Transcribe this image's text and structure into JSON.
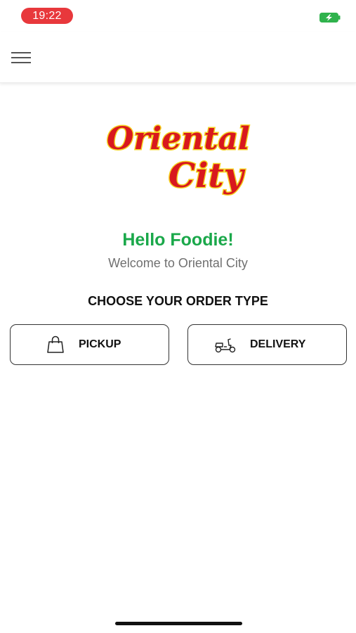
{
  "status_bar": {
    "time": "19:22"
  },
  "header": {
    "menu_icon": "hamburger-menu-icon"
  },
  "logo": {
    "line1": "Oriental",
    "line2": "City"
  },
  "greeting": "Hello Foodie!",
  "welcome": "Welcome to Oriental City",
  "order_type": {
    "heading": "CHOOSE YOUR ORDER TYPE",
    "pickup_label": "PICKUP",
    "pickup_icon": "shopping-bag-icon",
    "delivery_label": "DELIVERY",
    "delivery_icon": "scooter-icon"
  },
  "colors": {
    "accent_green": "#1aa84a",
    "time_pill": "#e8383c",
    "logo_red": "#d8181e",
    "logo_yellow": "#f5d21f"
  }
}
